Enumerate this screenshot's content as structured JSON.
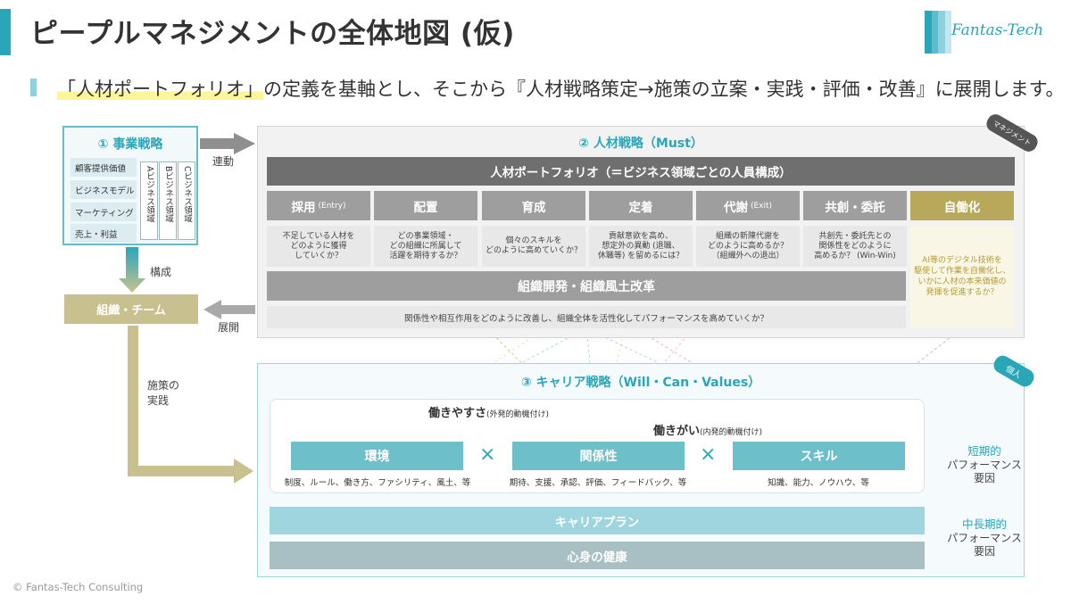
{
  "header": {
    "title": "ピープルマネジメントの全体地図 (仮)",
    "logo": "Fantas-Tech",
    "subtitle_highlight": "「人材ポートフォリオ」",
    "subtitle_rest": "の定義を基軸とし、そこから『人材戦略策定→施策の立案・実践・評価・改善』に展開します。"
  },
  "business": {
    "title": "① 事業戦略",
    "items": [
      "顧客提供価値",
      "ビジネスモデル",
      "マーケティング",
      "売上・利益"
    ],
    "domains": [
      "Aビジネス領域",
      "Bビジネス領域",
      "Cビジネス領域"
    ]
  },
  "flow": {
    "link": "連動",
    "compose": "構成",
    "deploy": "展開",
    "implement": "施策の\n実践"
  },
  "org_team": "組織・チーム",
  "hr": {
    "title": "② 人材戦略（Must）",
    "tag": "マネジメント",
    "portfolio": "人材ポートフォリオ（＝ビジネス領域ごとの人員構成）",
    "functions": [
      {
        "name": "採用",
        "sub": "(Entry)",
        "desc": "不足している人材を\nどのように獲得\nしていくか？"
      },
      {
        "name": "配置",
        "sub": "",
        "desc": "どの事業領域・\nどの組織に所属して\n活躍を期待するか？"
      },
      {
        "name": "育成",
        "sub": "",
        "desc": "個々のスキルを\nどのように高めていくか？"
      },
      {
        "name": "定着",
        "sub": "",
        "desc": "貢献意欲を高め、\n想定外の異動 (退職、\n休職等) を留めるには？"
      },
      {
        "name": "代謝",
        "sub": "(Exit)",
        "desc": "組織の新陳代謝を\nどのように高めるか？\n（組織外への退出）"
      },
      {
        "name": "共創・委託",
        "sub": "",
        "desc": "共創先・委託先との\n関係性をどのように\n高めるか？ (Win-Win)"
      }
    ],
    "automation": {
      "name": "自働化",
      "desc": "AI等のデジタル技術を\n駆使して作業を自働化し、\nいかに人材の本来価値の\n発揮を促進するか？"
    },
    "org_dev": "組織開発・組織風土改革",
    "org_dev_desc": "関係性や相互作用をどのように改善し、組織全体を活性化してパフォーマンスを高めていくか？"
  },
  "career": {
    "title": "③ キャリア戦略（Will・Can・Values）",
    "tag": "個人",
    "ease": {
      "label": "働きやすさ",
      "sub": "(外発的動機付け)"
    },
    "worth": {
      "label": "働きがい",
      "sub": "(内発的動機付け)"
    },
    "factors": [
      {
        "name": "環境",
        "desc": "制度、ルール、働き方、ファシリティ、風土、等"
      },
      {
        "name": "関係性",
        "desc": "期待、支援、承認、評価、フィードバック、等"
      },
      {
        "name": "スキル",
        "desc": "知識、能力、ノウハウ、等"
      }
    ],
    "times": "×",
    "career_plan": "キャリアプラン",
    "mind_body": "心身の健康",
    "short_term": {
      "accent": "短期的",
      "rest": "パフォーマンス\n要因"
    },
    "long_term": {
      "accent": "中長期的",
      "rest": "パフォーマンス\n要因"
    }
  },
  "footer": "© Fantas-Tech Consulting",
  "colors": {
    "accent": "#2aa6b9",
    "gold": "#b8a95a",
    "gray": "#6f6f6f"
  }
}
